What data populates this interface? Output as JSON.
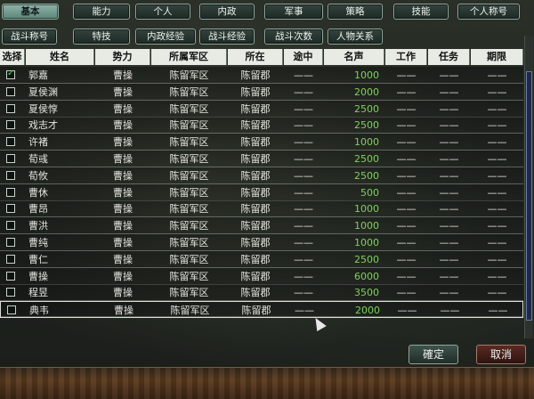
{
  "tabs_row1": [
    {
      "label": "基本",
      "active": true
    },
    {
      "label": "能力",
      "active": false
    },
    {
      "label": "个人",
      "active": false
    },
    {
      "label": "内政",
      "active": false
    },
    {
      "label": "军事",
      "active": false
    },
    {
      "label": "策略",
      "active": false
    },
    {
      "label": "技能",
      "active": false
    },
    {
      "label": "个人称号",
      "active": false
    }
  ],
  "tabs_row2": [
    {
      "label": "战斗称号"
    },
    {
      "label": "特技"
    },
    {
      "label": "内政经验"
    },
    {
      "label": "战斗经验"
    },
    {
      "label": "战斗次数"
    },
    {
      "label": "人物关系"
    }
  ],
  "columns": [
    "选择",
    "姓名",
    "势力",
    "所属军区",
    "所在",
    "途中",
    "名声",
    "工作",
    "任务",
    "期限"
  ],
  "dash": "——",
  "rows": [
    {
      "name": "郭嘉",
      "force": "曹操",
      "region": "陈留军区",
      "location": "陈留郡",
      "fame": "1000",
      "checked": true
    },
    {
      "name": "夏侯渊",
      "force": "曹操",
      "region": "陈留军区",
      "location": "陈留郡",
      "fame": "2000",
      "checked": false
    },
    {
      "name": "夏侯惇",
      "force": "曹操",
      "region": "陈留军区",
      "location": "陈留郡",
      "fame": "2500",
      "checked": false
    },
    {
      "name": "戏志才",
      "force": "曹操",
      "region": "陈留军区",
      "location": "陈留郡",
      "fame": "2500",
      "checked": false
    },
    {
      "name": "许褚",
      "force": "曹操",
      "region": "陈留军区",
      "location": "陈留郡",
      "fame": "1000",
      "checked": false
    },
    {
      "name": "荀彧",
      "force": "曹操",
      "region": "陈留军区",
      "location": "陈留郡",
      "fame": "2500",
      "checked": false
    },
    {
      "name": "荀攸",
      "force": "曹操",
      "region": "陈留军区",
      "location": "陈留郡",
      "fame": "2500",
      "checked": false
    },
    {
      "name": "曹休",
      "force": "曹操",
      "region": "陈留军区",
      "location": "陈留郡",
      "fame": "500",
      "checked": false
    },
    {
      "name": "曹昂",
      "force": "曹操",
      "region": "陈留军区",
      "location": "陈留郡",
      "fame": "1000",
      "checked": false
    },
    {
      "name": "曹洪",
      "force": "曹操",
      "region": "陈留军区",
      "location": "陈留郡",
      "fame": "1000",
      "checked": false
    },
    {
      "name": "曹纯",
      "force": "曹操",
      "region": "陈留军区",
      "location": "陈留郡",
      "fame": "1000",
      "checked": false
    },
    {
      "name": "曹仁",
      "force": "曹操",
      "region": "陈留军区",
      "location": "陈留郡",
      "fame": "2500",
      "checked": false
    },
    {
      "name": "曹操",
      "force": "曹操",
      "region": "陈留军区",
      "location": "陈留郡",
      "fame": "6000",
      "checked": false
    },
    {
      "name": "程昱",
      "force": "曹操",
      "region": "陈留军区",
      "location": "陈留郡",
      "fame": "3500",
      "checked": false
    },
    {
      "name": "典韦",
      "force": "曹操",
      "region": "陈留军区",
      "location": "陈留郡",
      "fame": "2000",
      "checked": false
    }
  ],
  "buttons": {
    "ok": "確定",
    "cancel": "取消"
  }
}
